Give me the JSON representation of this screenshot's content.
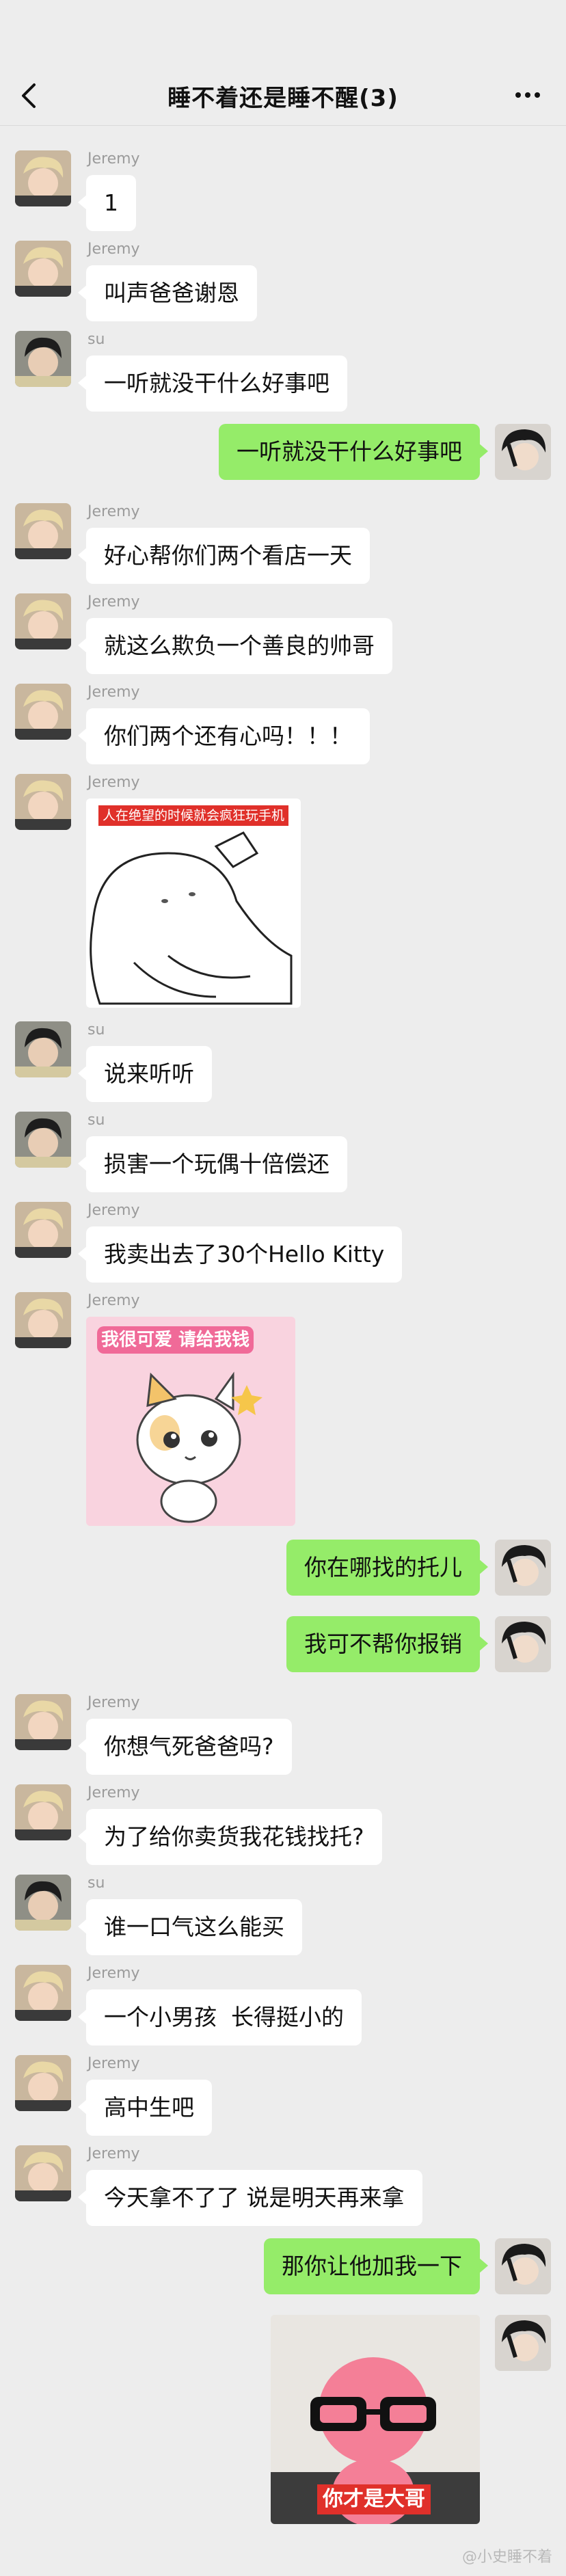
{
  "header": {
    "title": "睡不着还是睡不醒(3)"
  },
  "messages": [
    {
      "side": "left",
      "sender": "Jeremy",
      "text": "1"
    },
    {
      "side": "left",
      "sender": "Jeremy",
      "text": "叫声爸爸谢恩"
    },
    {
      "side": "left",
      "sender": "su",
      "text": "一听就没干什么好事吧"
    },
    {
      "side": "right",
      "sender": "",
      "text": "一听就没干什么好事吧"
    },
    {
      "side": "left",
      "sender": "Jeremy",
      "text": "好心帮你们两个看店一天"
    },
    {
      "side": "left",
      "sender": "Jeremy",
      "text": "就这么欺负一个善良的帅哥"
    },
    {
      "side": "left",
      "sender": "Jeremy",
      "text": "你们两个还有心吗！！！"
    },
    {
      "side": "left",
      "sender": "Jeremy",
      "sticker_caption": "人在绝望的时候就会疯狂玩手机"
    },
    {
      "side": "left",
      "sender": "su",
      "text": "说来听听"
    },
    {
      "side": "left",
      "sender": "su",
      "text": "损害一个玩偶十倍偿还"
    },
    {
      "side": "left",
      "sender": "Jeremy",
      "text": "我卖出去了30个Hello Kitty"
    },
    {
      "side": "left",
      "sender": "Jeremy",
      "sticker_caption": "我很可爱 请给我钱"
    },
    {
      "side": "right",
      "sender": "",
      "text": "你在哪找的托儿"
    },
    {
      "side": "right",
      "sender": "",
      "text": "我可不帮你报销"
    },
    {
      "side": "left",
      "sender": "Jeremy",
      "text": "你想气死爸爸吗?"
    },
    {
      "side": "left",
      "sender": "Jeremy",
      "text": "为了给你卖货我花钱找托?"
    },
    {
      "side": "left",
      "sender": "su",
      "text": "谁一口气这么能买"
    },
    {
      "side": "left",
      "sender": "Jeremy",
      "text": "一个小男孩  长得挺小的"
    },
    {
      "side": "left",
      "sender": "Jeremy",
      "text": "高中生吧"
    },
    {
      "side": "left",
      "sender": "Jeremy",
      "text": "今天拿不了了 说是明天再来拿"
    },
    {
      "side": "right",
      "sender": "",
      "text": "那你让他加我一下"
    },
    {
      "side": "right",
      "sender": "",
      "sticker_caption": "你才是大哥"
    }
  ],
  "watermark": "@小史睡不着"
}
